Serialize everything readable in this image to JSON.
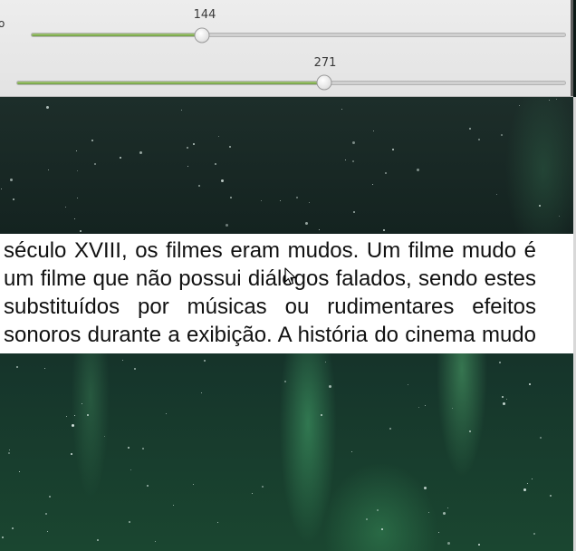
{
  "panel": {
    "partial_label": "o",
    "sliders": [
      {
        "name": "slider-1",
        "value_label": "144",
        "level": 0.32
      },
      {
        "name": "slider-2",
        "value_label": "271",
        "level": 0.56
      }
    ]
  },
  "caption": {
    "text": "século XVIII, os filmes eram mudos. Um filme mudo é um filme que não possui diálogos falados, sendo estes substituídos por músicas ou rudimentares efeitos sonoros durante a exibição. A história do cinema mudo foi marcada por grandes obras e é"
  },
  "colors": {
    "slider_fill": "#7aab4a",
    "panel_background": "#e8e8e8",
    "aurora_green": "#3f9a62",
    "night_sky": "#172824"
  },
  "icons": {
    "cursor": "arrow-pointer-icon",
    "knob": "slider-knob-icon"
  }
}
